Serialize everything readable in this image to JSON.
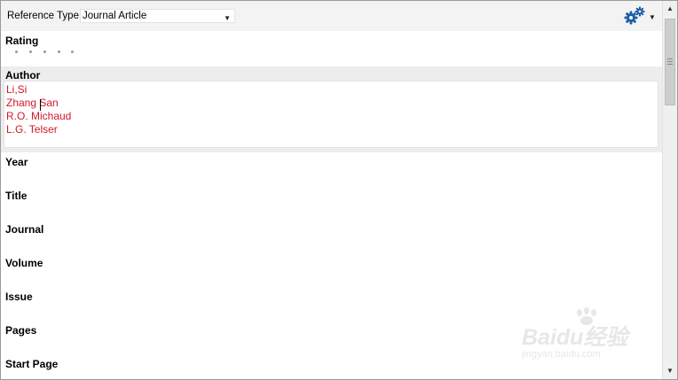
{
  "toolbar": {
    "reference_type_label": "Reference Type:",
    "reference_type_value": "Journal Article",
    "dropdown_icon": "triangle-down",
    "settings_icon": "gears-icon"
  },
  "fields": {
    "rating": {
      "label": "Rating",
      "value": 0,
      "max": 5
    },
    "author": {
      "label": "Author",
      "values": [
        "Li,Si",
        "Zhang San",
        "R.O. Michaud",
        "L.G. Telser"
      ],
      "text_color": "#d0192a"
    },
    "year": {
      "label": "Year"
    },
    "title": {
      "label": "Title"
    },
    "journal": {
      "label": "Journal"
    },
    "volume": {
      "label": "Volume"
    },
    "issue": {
      "label": "Issue"
    },
    "pages": {
      "label": "Pages"
    },
    "start_page": {
      "label": "Start Page"
    }
  },
  "watermark": {
    "brand": "Baidu经验",
    "url": "jingyan.baidu.com"
  }
}
